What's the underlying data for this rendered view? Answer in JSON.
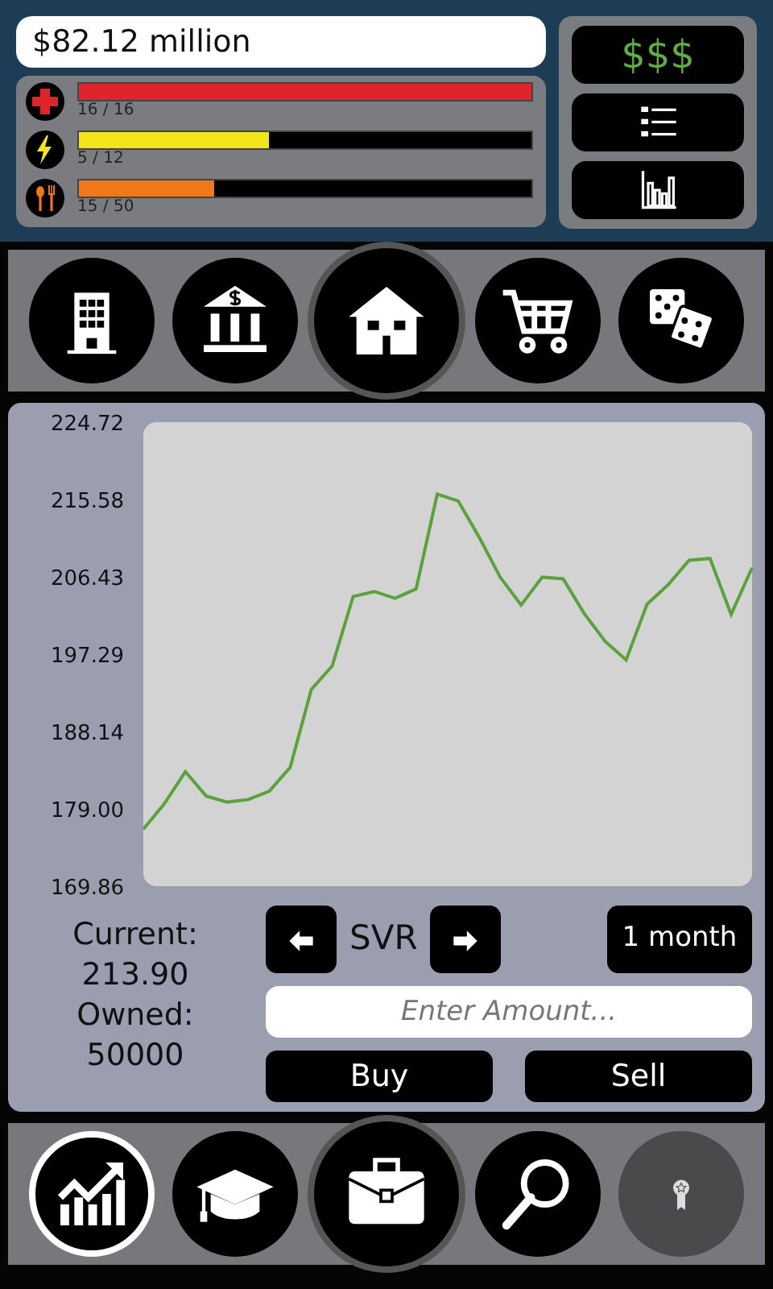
{
  "balance": "$82.12 million",
  "stats": [
    {
      "kind": "health",
      "color": "#e0242c",
      "level": 1,
      "reading": "16 / 16"
    },
    {
      "kind": "energy",
      "color": "#f2e51a",
      "level": 0.42,
      "reading": "5 / 12"
    },
    {
      "kind": "food",
      "color": "#f07818",
      "level": 0.3,
      "reading": "15 / 50"
    }
  ],
  "side_buttons": [
    {
      "kind": "money",
      "label": "$$$"
    },
    {
      "kind": "list"
    },
    {
      "kind": "chart"
    }
  ],
  "top_nav": [
    {
      "kind": "building"
    },
    {
      "kind": "bank"
    },
    {
      "kind": "home"
    },
    {
      "kind": "cart"
    },
    {
      "kind": "dice"
    }
  ],
  "chart_data": {
    "type": "line",
    "ylim": [
      169.86,
      224.72
    ],
    "yticks": [
      {
        "value": 169.86,
        "label": "169.86"
      },
      {
        "value": 179.0,
        "label": "179.00"
      },
      {
        "value": 188.14,
        "label": "188.14"
      },
      {
        "value": 197.29,
        "label": "197.29"
      },
      {
        "value": 206.43,
        "label": "206.43"
      },
      {
        "value": 215.58,
        "label": "215.58"
      },
      {
        "value": 224.72,
        "label": "224.72"
      }
    ],
    "series": [
      {
        "color": "#5aa23c",
        "values": [
          176.6,
          179.6,
          183.4,
          180.5,
          179.8,
          180.1,
          181.1,
          183.9,
          193.1,
          195.9,
          204.1,
          204.7,
          203.9,
          205.0,
          216.2,
          215.4,
          211.1,
          206.4,
          203.1,
          206.4,
          206.2,
          202.1,
          198.8,
          196.6,
          203.2,
          205.5,
          208.4,
          208.6,
          202.0,
          207.5
        ]
      }
    ]
  },
  "info": [
    {
      "label": "Current:",
      "value": "213.90"
    },
    {
      "label": "Owned:",
      "value": "50000"
    }
  ],
  "symbol": "SVR",
  "period": "1 month",
  "amount": {
    "placeholder": "Enter Amount..."
  },
  "actions": [
    "Buy",
    "Sell"
  ],
  "bottom_nav": [
    {
      "kind": "growth",
      "selected": true,
      "disabled": false
    },
    {
      "kind": "education",
      "selected": false,
      "disabled": false
    },
    {
      "kind": "briefcase",
      "selected": false,
      "disabled": false
    },
    {
      "kind": "search",
      "selected": false,
      "disabled": false
    },
    {
      "kind": "award",
      "selected": false,
      "disabled": true
    }
  ]
}
